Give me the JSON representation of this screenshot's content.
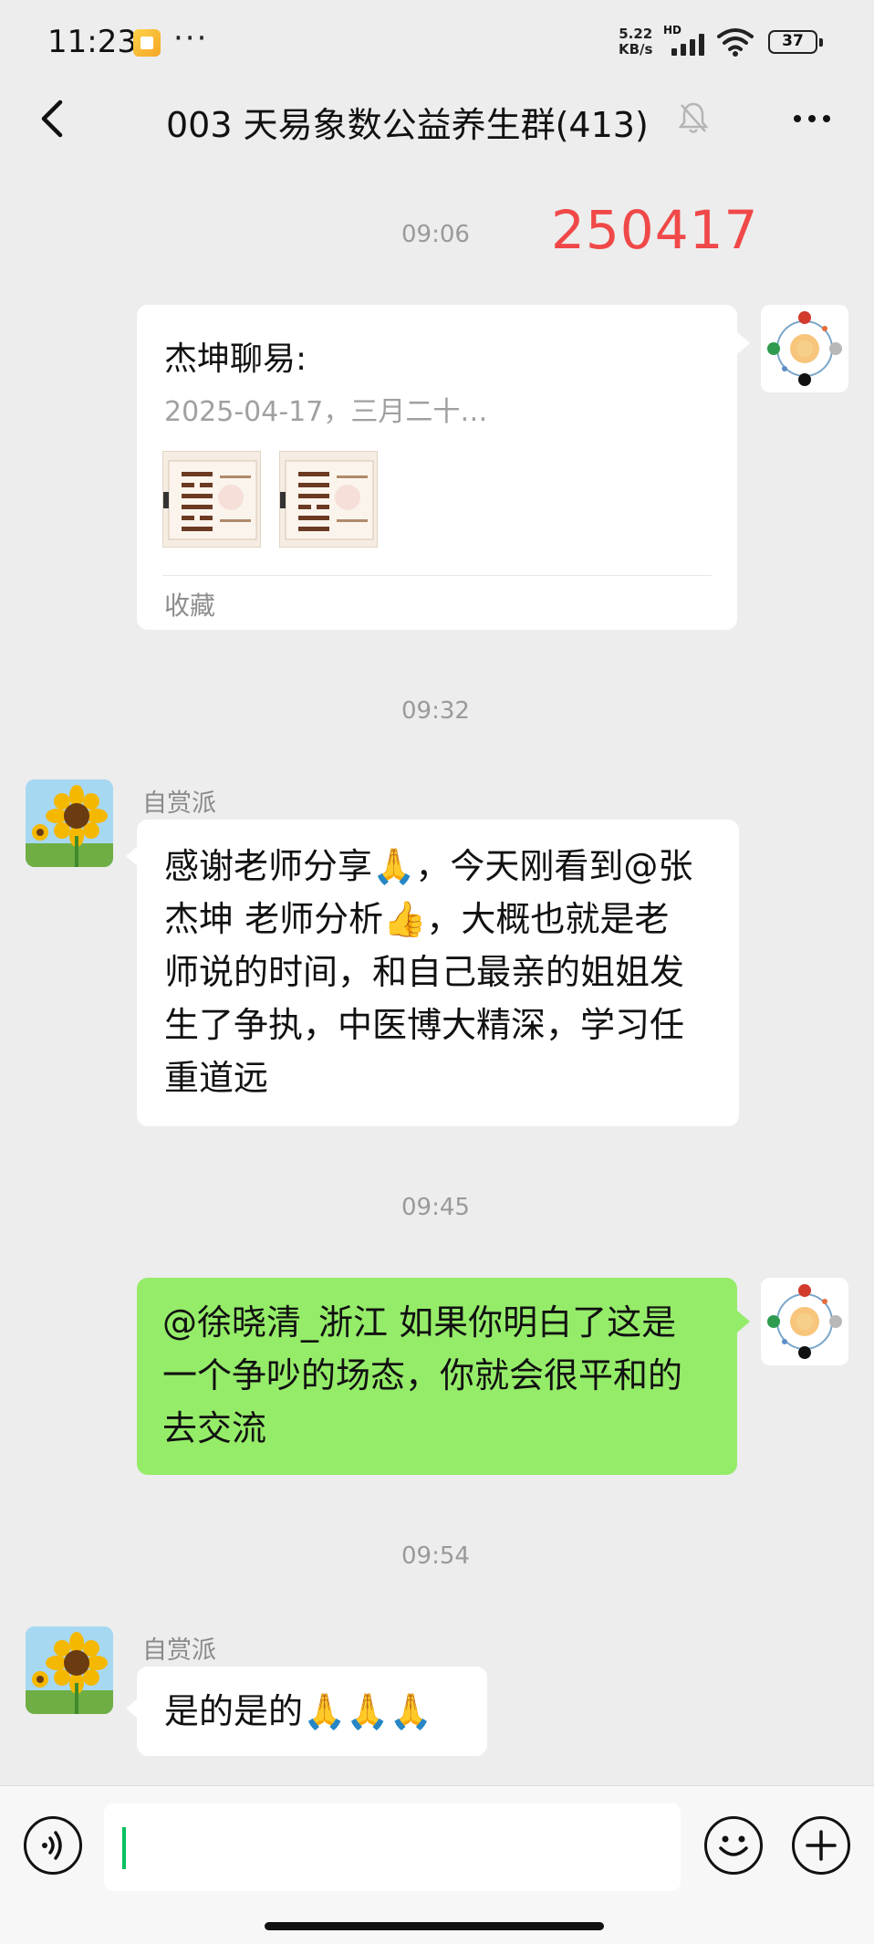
{
  "status_bar": {
    "time": "11:23",
    "more": "···",
    "net_speed_value": "5.22",
    "net_speed_unit": "KB/s",
    "network_label": "HD",
    "battery": "37"
  },
  "header": {
    "title": "003 天易象数公益养生群(413)",
    "back_icon": "chevron-left-icon",
    "mute_icon": "bell-off-icon",
    "more_icon": "more-horizontal-icon"
  },
  "annotation": {
    "text": "250417",
    "color": "#f04848"
  },
  "messages": [
    {
      "type": "timestamp",
      "text": "09:06"
    },
    {
      "type": "favorite_card",
      "side": "right",
      "title": "杰坤聊易:",
      "subtitle": "2025-04-17，三月二十…",
      "source": "收藏",
      "thumbnails": [
        "hexagram-image-1",
        "hexagram-image-2"
      ]
    },
    {
      "type": "timestamp",
      "text": "09:32"
    },
    {
      "type": "text",
      "side": "left",
      "sender": "自赏派",
      "lines": [
        "感谢老师分享🙏，今天刚看到@张",
        "杰坤 老师分析👍，大概也就是老",
        "师说的时间，和自己最亲的姐姐发",
        "生了争执，中医博大精深，学习任",
        "重道远"
      ]
    },
    {
      "type": "timestamp",
      "text": "09:45"
    },
    {
      "type": "text",
      "side": "right",
      "lines": [
        "@徐晓清_浙江  如果你明白了这是",
        "一个争吵的场态，你就会很平和的",
        "去交流"
      ]
    },
    {
      "type": "timestamp",
      "text": "09:54"
    },
    {
      "type": "text",
      "side": "left",
      "sender": "自赏派",
      "lines": [
        "是的是的🙏🙏🙏"
      ]
    }
  ],
  "input_bar": {
    "voice_icon": "voice-icon",
    "emoji_icon": "emoji-icon",
    "plus_icon": "plus-icon",
    "value": ""
  },
  "colors": {
    "background": "#ededed",
    "own_bubble": "#95ec69",
    "other_bubble": "#ffffff",
    "caret": "#07c160"
  }
}
